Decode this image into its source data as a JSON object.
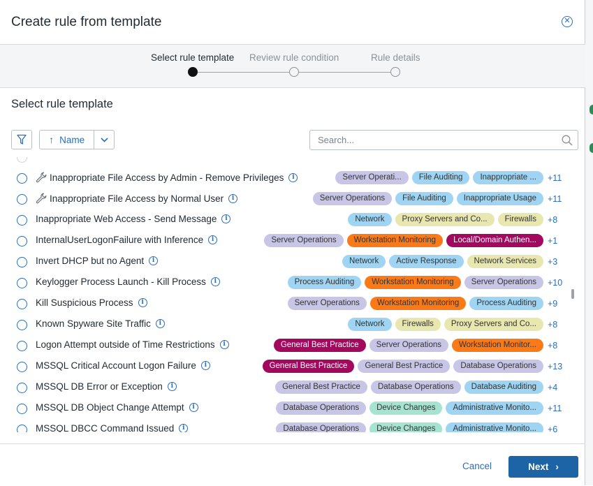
{
  "dialog": {
    "title": "Create rule from template"
  },
  "stepper": {
    "steps": [
      {
        "label": "Select rule template",
        "active": true
      },
      {
        "label": "Review rule condition",
        "active": false
      },
      {
        "label": "Rule details",
        "active": false
      }
    ]
  },
  "section_title": "Select rule template",
  "toolbar": {
    "sort_label": "Name",
    "search_placeholder": "Search..."
  },
  "tag_colors": {
    "lavender": "#c8c6e6",
    "blue": "#9fd5f2",
    "yellow": "#e9e7b0",
    "orange": "#f97a17",
    "magenta": "#a3085f",
    "teal": "#a6e3d0"
  },
  "rules": [
    {
      "name": "Inappropriate File Access by Admin - Remove Privileges",
      "wrench": true,
      "tags": [
        {
          "text": "Server Operati...",
          "color": "lavender"
        },
        {
          "text": "File Auditing",
          "color": "blue"
        },
        {
          "text": "Inappropriate ...",
          "color": "blue"
        }
      ],
      "more": "+11"
    },
    {
      "name": "Inappropriate File Access by Normal User",
      "wrench": true,
      "tags": [
        {
          "text": "Server Operations",
          "color": "lavender"
        },
        {
          "text": "File Auditing",
          "color": "blue"
        },
        {
          "text": "Inappropriate Usage",
          "color": "blue"
        }
      ],
      "more": "+11"
    },
    {
      "name": "Inappropriate Web Access - Send Message",
      "wrench": false,
      "tags": [
        {
          "text": "Network",
          "color": "blue"
        },
        {
          "text": "Proxy Servers and Co...",
          "color": "yellow"
        },
        {
          "text": "Firewalls",
          "color": "yellow"
        }
      ],
      "more": "+8"
    },
    {
      "name": "InternalUserLogonFailure with Inference",
      "wrench": false,
      "tags": [
        {
          "text": "Server Operations",
          "color": "lavender"
        },
        {
          "text": "Workstation Monitoring",
          "color": "orange"
        },
        {
          "text": "Local/Domain Authen...",
          "color": "magenta"
        }
      ],
      "more": "+1"
    },
    {
      "name": "Invert DHCP but no Agent",
      "wrench": false,
      "tags": [
        {
          "text": "Network",
          "color": "blue"
        },
        {
          "text": "Active Response",
          "color": "blue"
        },
        {
          "text": "Network Services",
          "color": "yellow"
        }
      ],
      "more": "+3"
    },
    {
      "name": "Keylogger Process Launch - Kill Process",
      "wrench": false,
      "tags": [
        {
          "text": "Process Auditing",
          "color": "blue"
        },
        {
          "text": "Workstation Monitoring",
          "color": "orange"
        },
        {
          "text": "Server Operations",
          "color": "lavender"
        }
      ],
      "more": "+10"
    },
    {
      "name": "Kill Suspicious Process",
      "wrench": false,
      "tags": [
        {
          "text": "Server Operations",
          "color": "lavender"
        },
        {
          "text": "Workstation Monitoring",
          "color": "orange"
        },
        {
          "text": "Process Auditing",
          "color": "blue"
        }
      ],
      "more": "+9"
    },
    {
      "name": "Known Spyware Site Traffic",
      "wrench": false,
      "tags": [
        {
          "text": "Network",
          "color": "blue"
        },
        {
          "text": "Firewalls",
          "color": "yellow"
        },
        {
          "text": "Proxy Servers and Co...",
          "color": "yellow"
        }
      ],
      "more": "+8"
    },
    {
      "name": "Logon Attempt outside of Time Restrictions",
      "wrench": false,
      "tags": [
        {
          "text": "General Best Practice",
          "color": "magenta"
        },
        {
          "text": "Server Operations",
          "color": "lavender"
        },
        {
          "text": "Workstation Monitor...",
          "color": "orange"
        }
      ],
      "more": "+8"
    },
    {
      "name": "MSSQL Critical Account Logon Failure",
      "wrench": false,
      "tags": [
        {
          "text": "General Best Practice",
          "color": "magenta"
        },
        {
          "text": "General Best Practice",
          "color": "lavender"
        },
        {
          "text": "Database Operations",
          "color": "lavender"
        }
      ],
      "more": "+13"
    },
    {
      "name": "MSSQL DB Error or Exception",
      "wrench": false,
      "tags": [
        {
          "text": "General Best Practice",
          "color": "lavender"
        },
        {
          "text": "Database Operations",
          "color": "lavender"
        },
        {
          "text": "Database Auditing",
          "color": "blue"
        }
      ],
      "more": "+4"
    },
    {
      "name": "MSSQL DB Object Change Attempt",
      "wrench": false,
      "tags": [
        {
          "text": "Database Operations",
          "color": "lavender"
        },
        {
          "text": "Device Changes",
          "color": "teal"
        },
        {
          "text": "Administrative Monito...",
          "color": "blue"
        }
      ],
      "more": "+11"
    },
    {
      "name": "MSSQL DBCC Command Issued",
      "wrench": false,
      "tags": [
        {
          "text": "Database Operations",
          "color": "lavender"
        },
        {
          "text": "Device Changes",
          "color": "teal"
        },
        {
          "text": "Administrative Monito...",
          "color": "blue"
        }
      ],
      "more": "+6"
    }
  ],
  "footer": {
    "cancel_label": "Cancel",
    "next_label": "Next"
  }
}
